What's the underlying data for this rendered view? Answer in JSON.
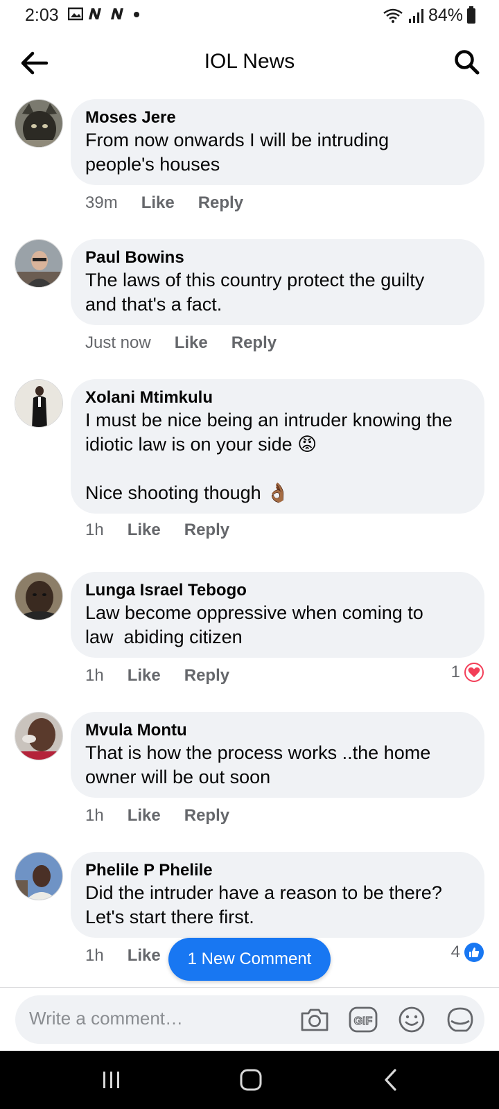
{
  "status_bar": {
    "time": "2:03",
    "battery": "84%"
  },
  "header": {
    "title": "IOL News"
  },
  "comments": [
    {
      "author": "Moses Jere",
      "text": "From now onwards I will be intruding people's houses",
      "time": "39m",
      "like": "Like",
      "reply": "Reply"
    },
    {
      "author": "Paul Bowins",
      "text": "The laws of this country protect the guilty and that's a fact.",
      "time": "Just now",
      "like": "Like",
      "reply": "Reply"
    },
    {
      "author": "Xolani Mtimkulu",
      "text": "I must be nice being an intruder knowing the idiotic law is on your side 😡\n\nNice shooting though 👌🏾",
      "time": "1h",
      "like": "Like",
      "reply": "Reply"
    },
    {
      "author": "Lunga Israel Tebogo",
      "text": "Law become oppressive when coming to law  abiding citizen",
      "time": "1h",
      "like": "Like",
      "reply": "Reply",
      "reaction_count": "1",
      "reaction_type": "heart-icon"
    },
    {
      "author": "Mvula Montu",
      "text": "That is how the process works ..the home owner will be out soon",
      "time": "1h",
      "like": "Like",
      "reply": "Reply"
    },
    {
      "author": "Phelile P Phelile",
      "text": "Did the intruder have a reason to be there? Let's start there first.",
      "time": "1h",
      "like": "Like",
      "reaction_count": "4",
      "reaction_type": "thumbs-up-icon"
    }
  ],
  "new_comment_pill": "1 New Comment",
  "composer": {
    "placeholder": "Write a comment…"
  },
  "colors": {
    "accent": "#1877f2",
    "bubble": "#f0f2f5",
    "meta": "#65676b",
    "heart": "#f33e58"
  }
}
